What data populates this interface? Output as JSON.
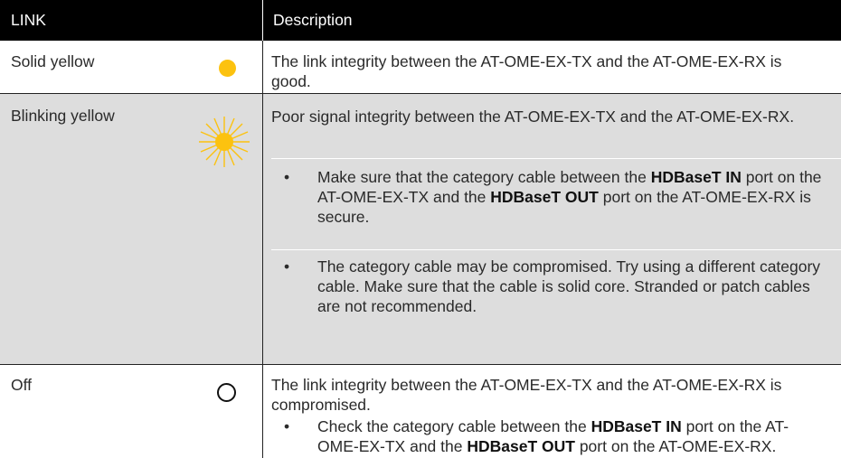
{
  "header": {
    "link": "LINK",
    "description": "Description"
  },
  "colors": {
    "header_bg": "#000000",
    "row_alt_bg": "#dddddd",
    "led_yellow": "#fcc20f",
    "text": "#2a2a2a"
  },
  "rows": [
    {
      "label": "Solid yellow",
      "icon": "led-solid-yellow-icon",
      "description": "The link integrity between the AT-OME-EX-TX and the AT-OME-EX-RX is good."
    },
    {
      "label": "Blinking yellow",
      "icon": "led-blinking-yellow-icon",
      "description": "Poor signal integrity between the AT-OME-EX-TX and the AT-OME-EX-RX.",
      "bullets": [
        {
          "p1": "Make sure that the category cable between the ",
          "b1": "HDBaseT IN",
          "p2": " port on the AT-OME-EX-TX and the ",
          "b2": "HDBaseT OUT",
          "p3": " port on the AT-OME-EX-RX is secure."
        },
        {
          "text": "The category cable may be compromised.  Try using a different category cable.  Make sure that the cable is solid core.  Stranded or patch cables are not recommended."
        }
      ]
    },
    {
      "label": "Off",
      "icon": "led-off-icon",
      "description": "The link integrity between the AT-OME-EX-TX and the AT-OME-EX-RX is compromised.",
      "bullets": [
        {
          "p1": "Check the category cable between the ",
          "b1": "HDBaseT IN",
          "p2": " port on the AT-OME-EX-TX and the ",
          "b2": "HDBaseT OUT",
          "p3": " port on the AT-OME-EX-RX."
        }
      ]
    }
  ],
  "bullet_char": "•"
}
